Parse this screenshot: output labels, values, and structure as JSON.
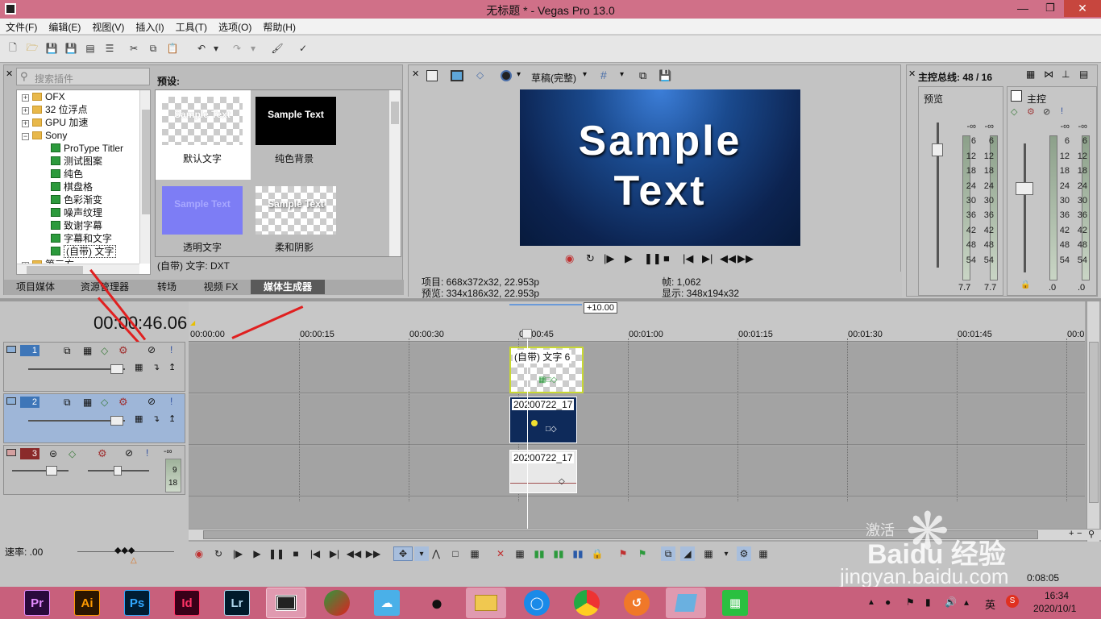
{
  "window": {
    "title": "无标题 * - Vegas Pro 13.0"
  },
  "menu": [
    "文件(F)",
    "编辑(E)",
    "视图(V)",
    "插入(I)",
    "工具(T)",
    "选项(O)",
    "帮助(H)"
  ],
  "plugins": {
    "search_placeholder": "搜索插件",
    "tree": [
      "OFX",
      "32 位浮点",
      "GPU 加速",
      "Sony",
      "ProType Titler",
      "测试图案",
      "纯色",
      "棋盘格",
      "色彩渐变",
      "噪声纹理",
      "致谢字幕",
      "字幕和文字",
      "(自带) 文字",
      "第三方"
    ],
    "presets_label": "预设:",
    "presets": [
      "默认文字",
      "纯色背景",
      "透明文字",
      "柔和阴影"
    ],
    "sample": "Sample Text",
    "status": "(自带) 文字: DXT"
  },
  "tabs": [
    "项目媒体",
    "资源管理器",
    "转场",
    "视频 FX",
    "媒体生成器"
  ],
  "preview": {
    "quality": "草稿(完整)",
    "sample_line1": "Sample",
    "sample_line2": "Text",
    "project": "项目: 668x372x32, 22.953p",
    "preview": "预览: 334x186x32, 22.953p",
    "frame": "帧:    1,062",
    "display": "显示: 348x194x32"
  },
  "master": {
    "title": "主控总线: 48 / 16",
    "preview_label": "预览",
    "master_label": "主控",
    "scale": [
      "-∞",
      "6",
      "12",
      "18",
      "24",
      "30",
      "36",
      "42",
      "48",
      "54"
    ],
    "left_vals": [
      "7.7",
      "7.7"
    ],
    "right_vals": [
      ".0",
      ".0"
    ],
    "minus_inf": "-∞"
  },
  "timeline": {
    "time": "00:00:46.06",
    "offset": "+10.00",
    "ruler": [
      "00:00:00",
      "00:00:15",
      "00:00:30",
      "00:00:45",
      "00:01:00",
      "00:01:15",
      "00:01:30",
      "00:01:45",
      "00:0"
    ],
    "tracks": [
      "1",
      "2",
      "3"
    ],
    "audio_vals": [
      "-∞",
      "9",
      "18"
    ],
    "clips": [
      "(自带) 文字 6",
      "20200722_17",
      "20200722_17"
    ],
    "rate": "速率: .00"
  },
  "taskbar": {
    "apps": [
      "Pr",
      "Ai",
      "Ps",
      "Id",
      "Lr"
    ],
    "ime": "英",
    "time": "16:34",
    "date": "2020/10/1",
    "status_time": "0:08:05"
  },
  "watermark": {
    "brand": "Baidu 经验",
    "url": "jingyan.baidu.com",
    "activate": "激活"
  }
}
